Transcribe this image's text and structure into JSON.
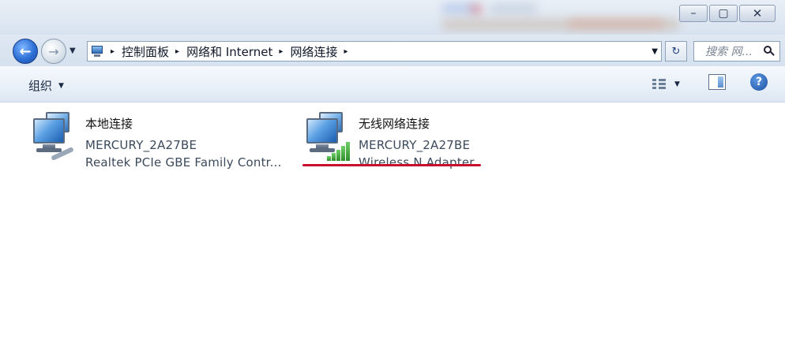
{
  "window": {
    "controls": {
      "minimize": "–",
      "maximize": "▢",
      "close": "✕"
    }
  },
  "nav": {
    "back_icon": "←",
    "forward_icon": "→",
    "history_dropdown": "▼"
  },
  "address": {
    "breadcrumbs": [
      "控制面板",
      "网络和 Internet",
      "网络连接"
    ],
    "separator": "▸",
    "dropdown": "▼"
  },
  "refresh": {
    "label": "↻"
  },
  "search": {
    "placeholder": "搜索 网..."
  },
  "toolbar": {
    "organize_label": "组织",
    "organize_arrow": "▼",
    "view_arrow": "▼",
    "help_label": "?"
  },
  "connections": [
    {
      "name": "本地连接",
      "network": "MERCURY_2A27BE",
      "adapter": "Realtek PCIe GBE Family Contr..."
    },
    {
      "name": "无线网络连接",
      "network": "MERCURY_2A27BE",
      "adapter": "Wireless N Adapter"
    }
  ],
  "colors": {
    "underline": "#c8102e",
    "signal": "#2e8f2a"
  }
}
